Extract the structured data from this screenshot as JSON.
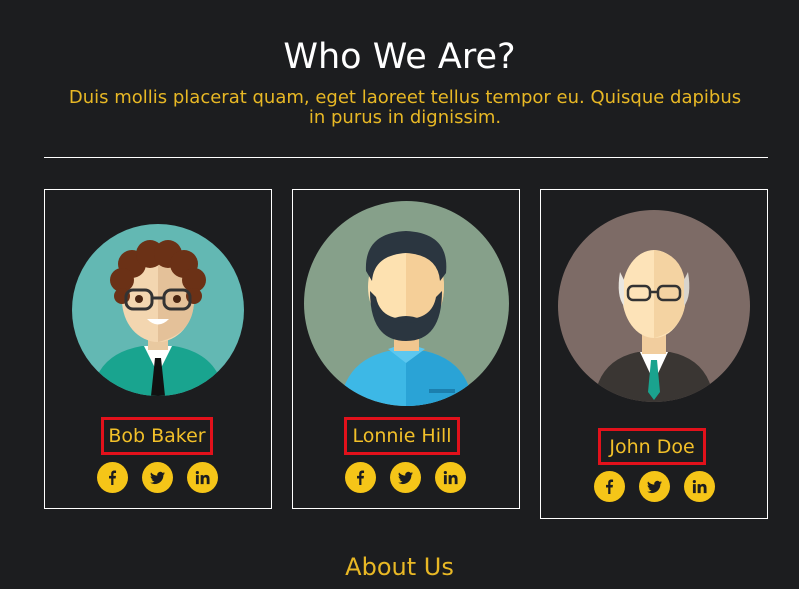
{
  "section": {
    "title": "Who We Are?",
    "intro": "Duis mollis placerat quam, eget laoreet tellus tempor eu. Quisque dapibus in purus in dignissim."
  },
  "team": [
    {
      "name": "Bob Baker"
    },
    {
      "name": "Lonnie Hill"
    },
    {
      "name": "John Doe"
    }
  ],
  "social_icons": [
    "facebook-icon",
    "twitter-icon",
    "linkedin-icon"
  ],
  "footer": {
    "heading": "About Us"
  },
  "colors": {
    "background": "#1c1d1f",
    "accent": "#f5c518",
    "text_accent": "#e8b825",
    "highlight_border": "#e2111b"
  }
}
